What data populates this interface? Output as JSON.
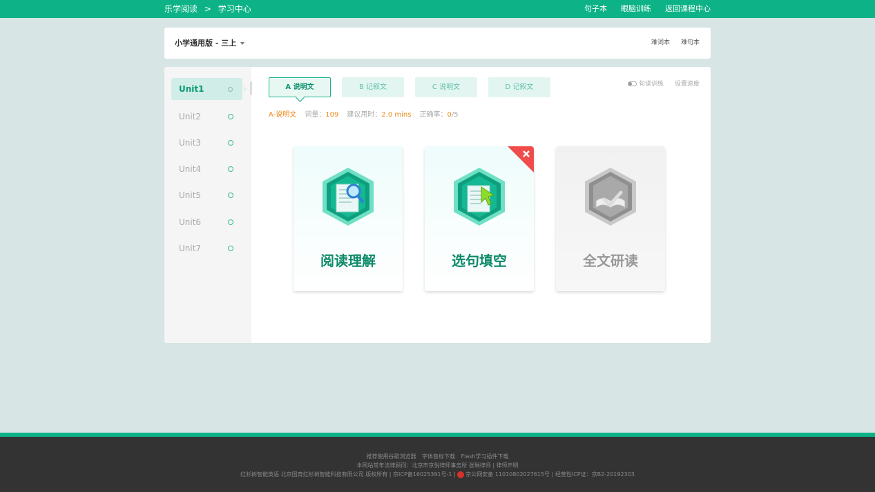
{
  "topbar": {
    "crumb_home": "乐学阅读",
    "crumb_sep": ">",
    "crumb_current": "学习中心",
    "nav": [
      "句子本",
      "眼脑训练",
      "返回课程中心"
    ]
  },
  "header": {
    "grade": "小学通用版 - 三上",
    "links": [
      "难词本",
      "难句本"
    ]
  },
  "units": [
    "Unit1",
    "Unit2",
    "Unit3",
    "Unit4",
    "Unit5",
    "Unit6",
    "Unit7"
  ],
  "tabs": [
    {
      "label": "A  说明文",
      "active": true
    },
    {
      "label": "B  记叙文",
      "active": false
    },
    {
      "label": "C  说明文",
      "active": false
    },
    {
      "label": "D  记叙文",
      "active": false
    }
  ],
  "options": {
    "toggle_label": "句读训练",
    "speed_label": "设置速度"
  },
  "info": {
    "title": "A-说明文",
    "words_label": "词量：",
    "words_value": "109",
    "time_label": "建议用时：",
    "time_value": "2.0 mins",
    "accuracy_label": "正确率：",
    "accuracy_value": "0",
    "accuracy_total": "/5"
  },
  "tiles": [
    {
      "title": "阅读理解",
      "icon": "reading-comprehension-icon",
      "enabled": true
    },
    {
      "title": "选句填空",
      "icon": "sentence-fill-icon",
      "enabled": true,
      "badge": "close-icon"
    },
    {
      "title": "全文研读",
      "icon": "full-text-study-icon",
      "enabled": false
    }
  ],
  "footer": {
    "line1": [
      "推荐使用谷歌浏览器",
      "字体音标下载",
      "Flash学习插件下载"
    ],
    "line2": "本网站常年法律顾问：北京市京悦律师事务所 张琳律师 | 律师声明",
    "line3_a": "红杉树智能英语 北京国育红杉树智能科技有限公司 版权所有 | 京ICP备16025391号-1 |",
    "line3_b": "京公网安备 11010802027615号 | 经营性ICP证：京B2-20192303"
  },
  "colors": {
    "brand": "#0db386",
    "accent_orange": "#ef8a1b",
    "background": "#d7e5e4"
  }
}
